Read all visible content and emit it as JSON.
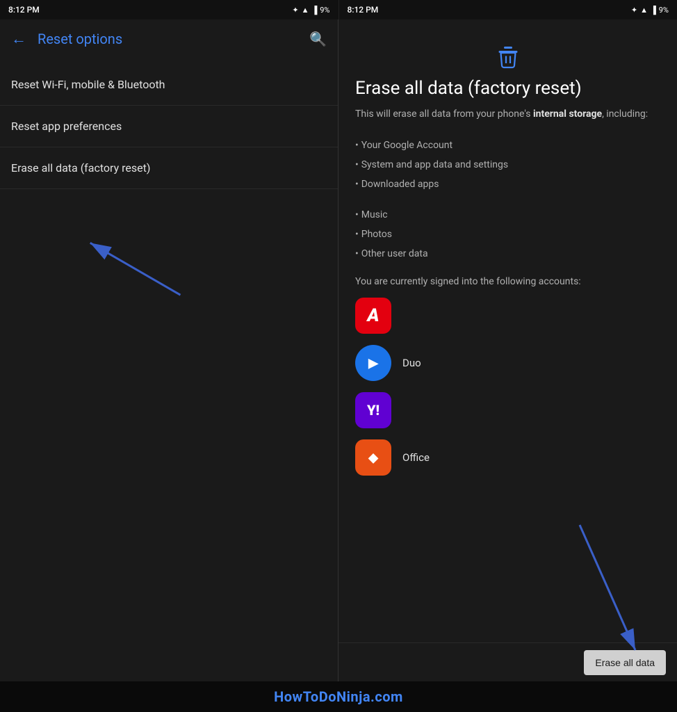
{
  "left": {
    "status": {
      "time": "8:12 PM",
      "battery": "9%"
    },
    "toolbar": {
      "back_label": "←",
      "title": "Reset options",
      "search_label": "🔍"
    },
    "menu": [
      {
        "label": "Reset Wi-Fi, mobile & Bluetooth"
      },
      {
        "label": "Reset app preferences"
      },
      {
        "label": "Erase all data (factory reset)"
      }
    ]
  },
  "right": {
    "status": {
      "time": "8:12 PM",
      "battery": "9%"
    },
    "title": "Erase all data (factory reset)",
    "description_start": "This will erase all data from your phone's ",
    "description_bold": "internal storage",
    "description_end": ", including:",
    "items": [
      "Your Google Account",
      "System and app data and settings",
      "Downloaded apps",
      "Music",
      "Photos",
      "Other user data"
    ],
    "accounts_text": "You are currently signed into the following accounts:",
    "apps": [
      {
        "name": "",
        "type": "adobe"
      },
      {
        "name": "Duo",
        "type": "duo"
      },
      {
        "name": "",
        "type": "yahoo"
      },
      {
        "name": "Office",
        "type": "office"
      }
    ],
    "erase_button": "Erase all data"
  },
  "watermark": "HowToDoNinja.com"
}
